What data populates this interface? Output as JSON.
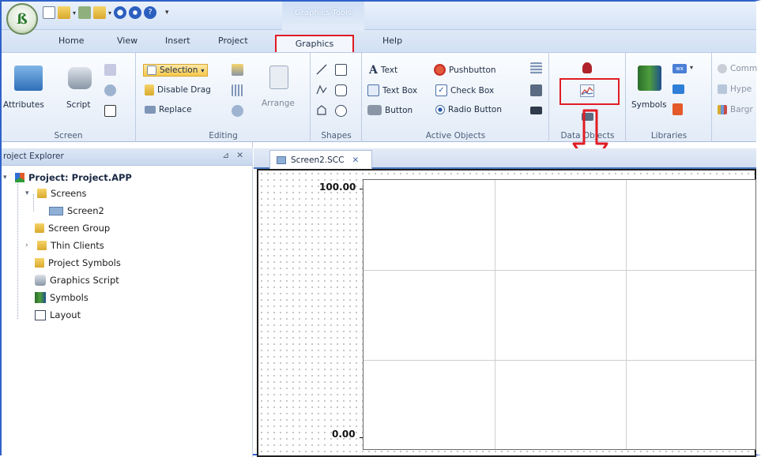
{
  "context_tab": "Graphics Tools",
  "tabs": [
    "Home",
    "View",
    "Insert",
    "Project",
    "Graphics",
    "Help"
  ],
  "ribbon": {
    "screen": {
      "label": "Screen",
      "attributes": "Attributes",
      "script": "Script"
    },
    "editing": {
      "label": "Editing",
      "selection": "Selection",
      "disable_drag": "Disable Drag",
      "replace": "Replace",
      "arrange": "Arrange"
    },
    "shapes": {
      "label": "Shapes"
    },
    "active_objects": {
      "label": "Active Objects",
      "text": "Text",
      "text_box": "Text Box",
      "button": "Button",
      "pushbutton": "Pushbutton",
      "check_box": "Check Box",
      "radio_button": "Radio Button"
    },
    "data_objects": {
      "label": "Data Objects"
    },
    "libraries": {
      "label": "Libraries",
      "symbols": "Symbols"
    },
    "partial": {
      "comm": "Comm",
      "hyper": "Hype",
      "barg": "Bargr"
    }
  },
  "explorer": {
    "title": "roject Explorer",
    "tree": {
      "project": "Project: Project.APP",
      "screens": "Screens",
      "screen2": "Screen2",
      "screen_group": "Screen Group",
      "thin_clients": "Thin Clients",
      "project_symbols": "Project Symbols",
      "graphics_script": "Graphics Script",
      "symbols": "Symbols",
      "layout": "Layout"
    }
  },
  "document": {
    "tab": "Screen2.SCC"
  },
  "trend": {
    "y_max": "100.00",
    "y_min": "0.00"
  },
  "colors": {
    "highlight": "#e11c24",
    "accent": "#2f61c9"
  }
}
